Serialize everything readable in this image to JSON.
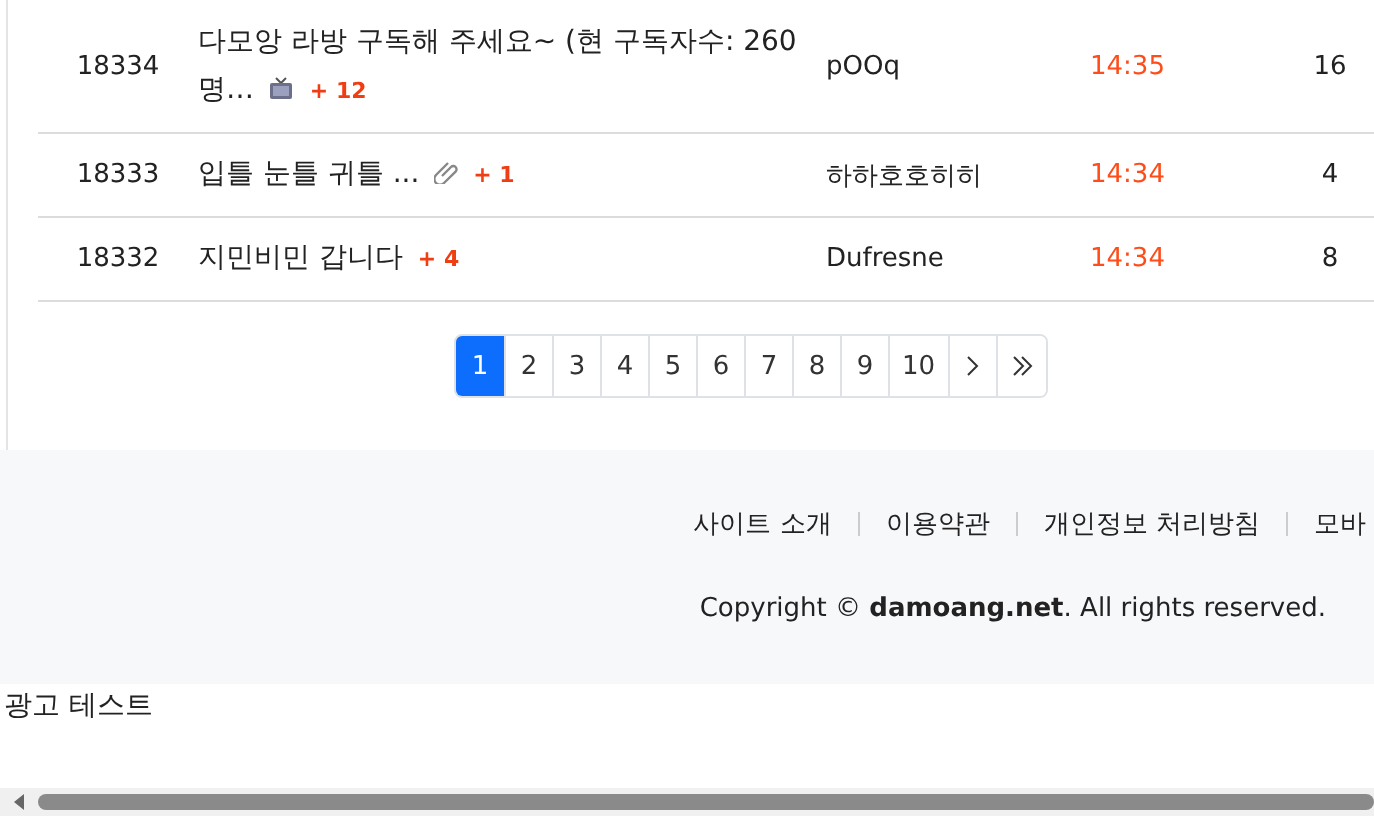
{
  "posts": [
    {
      "number": "18334",
      "title": "다모앙 라방 구독해 주세요~ (현 구독자수: 260명…",
      "kind": "video",
      "comments": "+ 12",
      "author": "pOOq",
      "time": "14:35",
      "views": "16"
    },
    {
      "number": "18333",
      "title": "입틀 눈틀 귀틀 ...",
      "kind": "link",
      "comments": "+ 1",
      "author": "하하호호히히",
      "time": "14:34",
      "views": "4"
    },
    {
      "number": "18332",
      "title": "지민비민 갑니다",
      "kind": "plain",
      "comments": "+ 4",
      "author": "Dufresne",
      "time": "14:34",
      "views": "8"
    }
  ],
  "pagination": [
    {
      "kind": "page",
      "label": "1",
      "selected": true
    },
    {
      "kind": "page",
      "label": "2",
      "selected": false
    },
    {
      "kind": "page",
      "label": "3",
      "selected": false
    },
    {
      "kind": "page",
      "label": "4",
      "selected": false
    },
    {
      "kind": "page",
      "label": "5",
      "selected": false
    },
    {
      "kind": "page",
      "label": "6",
      "selected": false
    },
    {
      "kind": "page",
      "label": "7",
      "selected": false
    },
    {
      "kind": "page",
      "label": "8",
      "selected": false
    },
    {
      "kind": "page",
      "label": "9",
      "selected": false
    },
    {
      "kind": "page",
      "label": "10",
      "selected": false
    },
    {
      "kind": "next",
      "selected": false
    },
    {
      "kind": "last",
      "selected": false
    }
  ],
  "footer": {
    "links": [
      "사이트 소개",
      "이용약관",
      "개인정보 처리방침",
      "모바"
    ],
    "copyright": "Copyright © **damoang.net**. All rights reserved."
  },
  "ad_text": "광고 테스트"
}
